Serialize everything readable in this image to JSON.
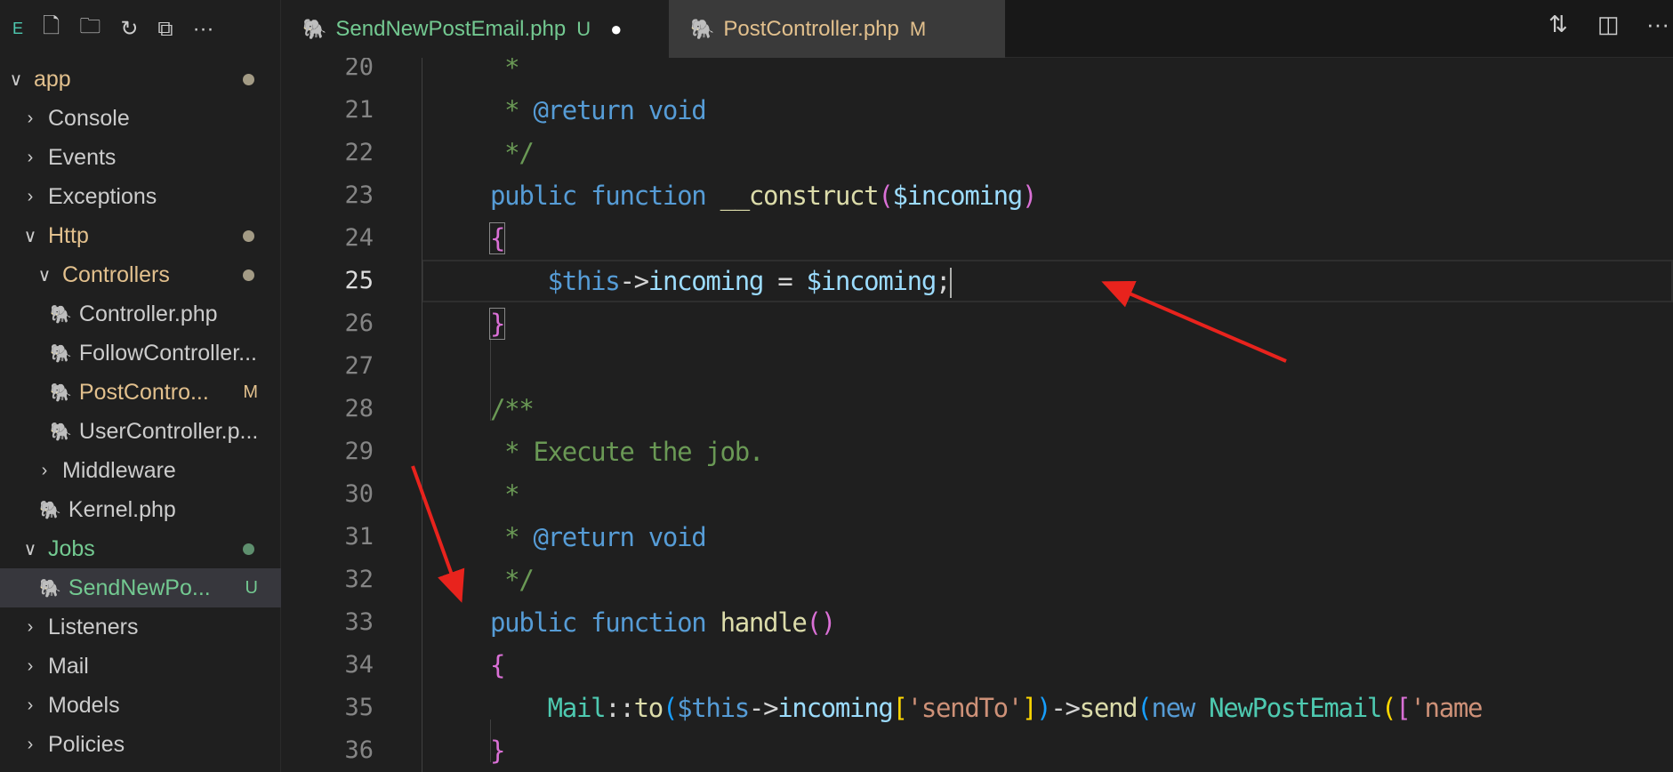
{
  "sidebar": {
    "title_letter": "E",
    "toolbar_icons": [
      "new-file-icon",
      "new-folder-icon",
      "refresh-icon",
      "collapse-all-icon",
      "more-icon"
    ],
    "more": "···",
    "items": [
      {
        "label": "app",
        "depth": 0,
        "chev": "v",
        "color": "#e2c08d",
        "dot": "#a39b85"
      },
      {
        "label": "Console",
        "depth": 1,
        "chev": ">",
        "color": "#cccccc"
      },
      {
        "label": "Events",
        "depth": 1,
        "chev": ">",
        "color": "#cccccc"
      },
      {
        "label": "Exceptions",
        "depth": 1,
        "chev": ">",
        "color": "#cccccc"
      },
      {
        "label": "Http",
        "depth": 1,
        "chev": "v",
        "color": "#e2c08d",
        "dot": "#a39b85"
      },
      {
        "label": "Controllers",
        "depth": 2,
        "chev": "v",
        "color": "#e2c08d",
        "dot": "#a39b85"
      },
      {
        "label": "Controller.php",
        "depth": 3,
        "file": true,
        "color": "#cccccc"
      },
      {
        "label": "FollowController...",
        "depth": 3,
        "file": true,
        "color": "#cccccc"
      },
      {
        "label": "PostContro...",
        "depth": 3,
        "file": true,
        "color": "#e2c08d",
        "badge": "M"
      },
      {
        "label": "UserController.p...",
        "depth": 3,
        "file": true,
        "color": "#cccccc"
      },
      {
        "label": "Middleware",
        "depth": 2,
        "chev": ">",
        "color": "#cccccc"
      },
      {
        "label": "Kernel.php",
        "depth": 2,
        "file": true,
        "color": "#cccccc"
      },
      {
        "label": "Jobs",
        "depth": 1,
        "chev": "v",
        "color": "#73c991",
        "dot": "#5e8f6e"
      },
      {
        "label": "SendNewPo...",
        "depth": 2,
        "file": true,
        "color": "#73c991",
        "badge": "U",
        "selected": true
      },
      {
        "label": "Listeners",
        "depth": 1,
        "chev": ">",
        "color": "#cccccc"
      },
      {
        "label": "Mail",
        "depth": 1,
        "chev": ">",
        "color": "#cccccc"
      },
      {
        "label": "Models",
        "depth": 1,
        "chev": ">",
        "color": "#cccccc"
      },
      {
        "label": "Policies",
        "depth": 1,
        "chev": ">",
        "color": "#cccccc"
      }
    ]
  },
  "tabs": [
    {
      "label": "SendNewPostEmail.php",
      "badge": "U",
      "color": "#73c991",
      "dirty": "●"
    },
    {
      "label": "PostController.php",
      "badge": "M",
      "color": "#e2c08d"
    }
  ],
  "tab_actions": {
    "compare": "⇅",
    "split": "◫",
    "more": "···"
  },
  "editor": {
    "current_line": 25,
    "lines": [
      {
        "n": 20,
        "t": [
          [
            " *",
            "c"
          ]
        ]
      },
      {
        "n": 21,
        "t": [
          [
            " * ",
            "c"
          ],
          [
            "@return",
            "k"
          ],
          [
            " void",
            "k"
          ]
        ]
      },
      {
        "n": 22,
        "t": [
          [
            " */",
            "c"
          ]
        ]
      },
      {
        "n": 23,
        "t": [
          [
            "public",
            "k"
          ],
          [
            " function ",
            "k"
          ],
          [
            "__construct",
            "f"
          ],
          [
            "(",
            "pk"
          ],
          [
            "$incoming",
            "v"
          ],
          [
            ")",
            "pk"
          ]
        ]
      },
      {
        "n": 24,
        "t": [
          [
            "{",
            "pk bh"
          ]
        ]
      },
      {
        "n": 25,
        "t": [
          [
            "    "
          ],
          [
            "$this",
            "k"
          ],
          [
            "->",
            "o"
          ],
          [
            "incoming",
            "v"
          ],
          [
            " = ",
            "o"
          ],
          [
            "$incoming",
            "v"
          ],
          [
            ";",
            "o"
          ]
        ]
      },
      {
        "n": 26,
        "t": [
          [
            "}",
            "pk bh"
          ]
        ]
      },
      {
        "n": 27,
        "t": []
      },
      {
        "n": 28,
        "t": [
          [
            "/**",
            "c"
          ]
        ]
      },
      {
        "n": 29,
        "t": [
          [
            " * Execute the job.",
            "c"
          ]
        ]
      },
      {
        "n": 30,
        "t": [
          [
            " *",
            "c"
          ]
        ]
      },
      {
        "n": 31,
        "t": [
          [
            " * ",
            "c"
          ],
          [
            "@return",
            "k"
          ],
          [
            " void",
            "k"
          ]
        ]
      },
      {
        "n": 32,
        "t": [
          [
            " */",
            "c"
          ]
        ]
      },
      {
        "n": 33,
        "t": [
          [
            "public",
            "k"
          ],
          [
            " function ",
            "k"
          ],
          [
            "handle",
            "f"
          ],
          [
            "()",
            "pk"
          ]
        ]
      },
      {
        "n": 34,
        "t": [
          [
            "{",
            "pk"
          ]
        ]
      },
      {
        "n": 35,
        "t": [
          [
            "    "
          ],
          [
            "Mail",
            "t"
          ],
          [
            "::",
            "o"
          ],
          [
            "to",
            "f"
          ],
          [
            "(",
            "bl"
          ],
          [
            "$this",
            "k"
          ],
          [
            "->",
            "o"
          ],
          [
            "incoming",
            "v"
          ],
          [
            "[",
            "p"
          ],
          [
            "'sendTo'",
            "s"
          ],
          [
            "]",
            "p"
          ],
          [
            ")",
            "bl"
          ],
          [
            "->",
            "o"
          ],
          [
            "send",
            "f"
          ],
          [
            "(",
            "bl"
          ],
          [
            "new",
            "k"
          ],
          [
            " "
          ],
          [
            "NewPostEmail",
            "t"
          ],
          [
            "(",
            "p"
          ],
          [
            "[",
            "pk"
          ],
          [
            "'name",
            "s"
          ]
        ]
      },
      {
        "n": 36,
        "t": [
          [
            "}",
            "pk"
          ]
        ]
      }
    ]
  },
  "colors": {
    "annotation_arrow": "#e8231d"
  }
}
